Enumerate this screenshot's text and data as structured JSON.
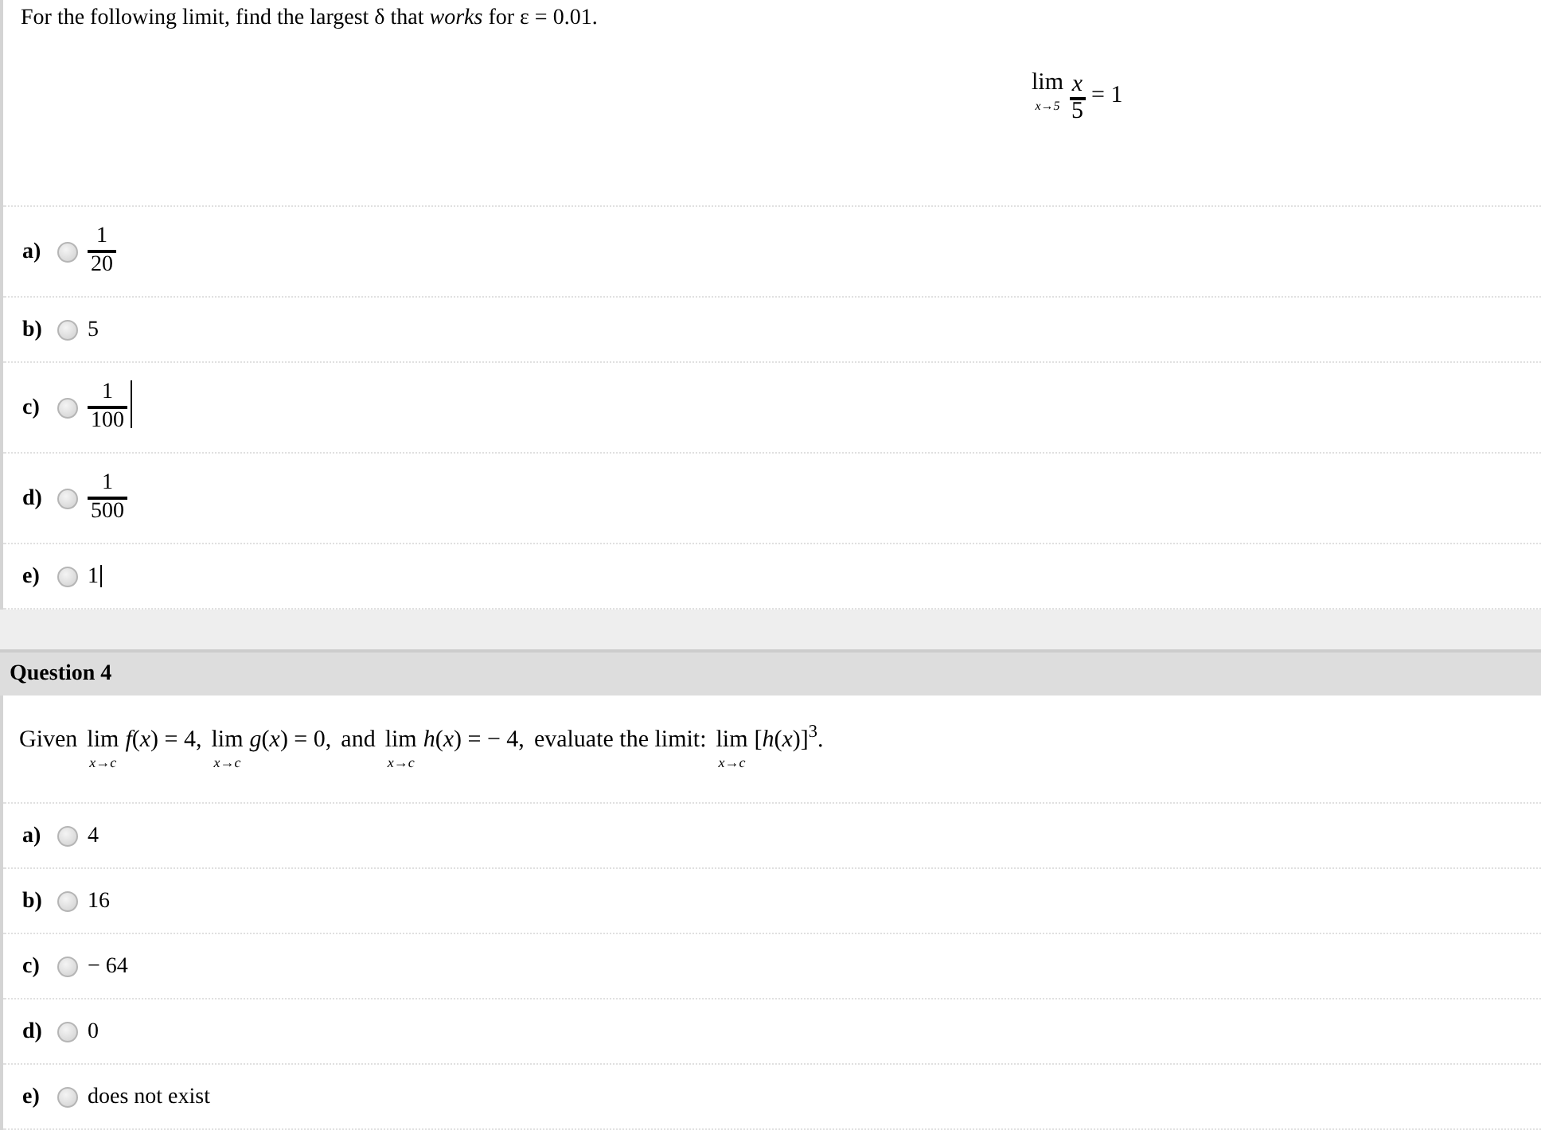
{
  "question_3": {
    "prompt": "For the following limit, find the largest δ that *works* for ε = 0.01.",
    "formula": {
      "lim": "lim",
      "under": "x→5",
      "numerator": "x",
      "denominator": "5",
      "rest": "= 1"
    },
    "choices": [
      {
        "label": "a)",
        "selected": false,
        "kind": "fraction",
        "numerator": "1",
        "denominator": "20",
        "caret": false
      },
      {
        "label": "b)",
        "selected": false,
        "kind": "text",
        "text": "5",
        "caret": false
      },
      {
        "label": "c)",
        "selected": false,
        "kind": "fraction",
        "numerator": "1",
        "denominator": "100",
        "caret": true
      },
      {
        "label": "d)",
        "selected": false,
        "kind": "fraction",
        "numerator": "1",
        "denominator": "500",
        "caret": false
      },
      {
        "label": "e)",
        "selected": false,
        "kind": "text",
        "text": "1",
        "caret": true
      }
    ]
  },
  "question_4": {
    "title": "Question 4",
    "prompt": [
      {
        "kind": "text",
        "text": "Given"
      },
      {
        "kind": "limit",
        "lim": "lim",
        "under": "x→c",
        "body": "*f*(*x*) = 4,"
      },
      {
        "kind": "limit",
        "lim": "lim",
        "under": "x→c",
        "body": "*g*(*x*) = 0,"
      },
      {
        "kind": "text",
        "text": "and"
      },
      {
        "kind": "limit",
        "lim": "lim",
        "under": "x→c",
        "body": "*h*(*x*) = − 4,"
      },
      {
        "kind": "text",
        "text": "evaluate the limit:"
      },
      {
        "kind": "limit",
        "lim": "lim",
        "under": "x→c",
        "body": "[*h*(*x*)]$^{3}$."
      }
    ],
    "choices": [
      {
        "label": "a)",
        "selected": false,
        "text": "4"
      },
      {
        "label": "b)",
        "selected": false,
        "text": "16"
      },
      {
        "label": "c)",
        "selected": false,
        "text": "− 64"
      },
      {
        "label": "d)",
        "selected": false,
        "text": "0"
      },
      {
        "label": "e)",
        "selected": false,
        "text": "does not exist"
      }
    ]
  }
}
